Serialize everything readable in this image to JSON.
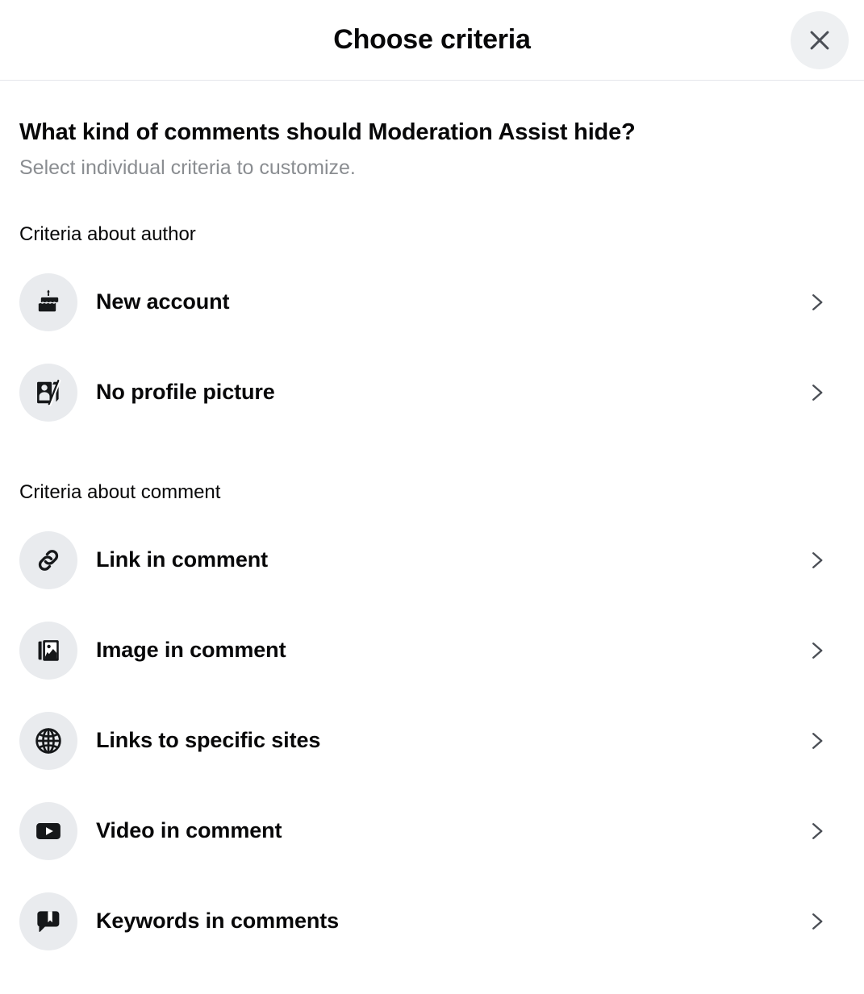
{
  "header": {
    "title": "Choose criteria",
    "close_icon": "close-icon"
  },
  "prompt": {
    "heading": "What kind of comments should Moderation Assist hide?",
    "subtitle": "Select individual criteria to customize."
  },
  "sections": [
    {
      "label": "Criteria about author",
      "items": [
        {
          "label": "New account",
          "icon": "birthday-cake-icon",
          "chevron": "chevron-right-icon"
        },
        {
          "label": "No profile picture",
          "icon": "no-profile-picture-icon",
          "chevron": "chevron-right-icon"
        }
      ]
    },
    {
      "label": "Criteria about comment",
      "items": [
        {
          "label": "Link in comment",
          "icon": "link-icon",
          "chevron": "chevron-right-icon"
        },
        {
          "label": "Image in comment",
          "icon": "image-icon",
          "chevron": "chevron-right-icon"
        },
        {
          "label": "Links to specific sites",
          "icon": "globe-icon",
          "chevron": "chevron-right-icon"
        },
        {
          "label": "Video in comment",
          "icon": "video-play-icon",
          "chevron": "chevron-right-icon"
        },
        {
          "label": "Keywords in comments",
          "icon": "comment-bookmark-icon",
          "chevron": "chevron-right-icon"
        }
      ]
    }
  ],
  "colors": {
    "text_primary": "#080809",
    "text_secondary": "#8a8d91",
    "icon_bubble_bg": "#e9ebee",
    "close_bg": "#eef0f2",
    "divider": "#e4e6eb",
    "chevron": "#4b4f56",
    "background": "#ffffff"
  }
}
